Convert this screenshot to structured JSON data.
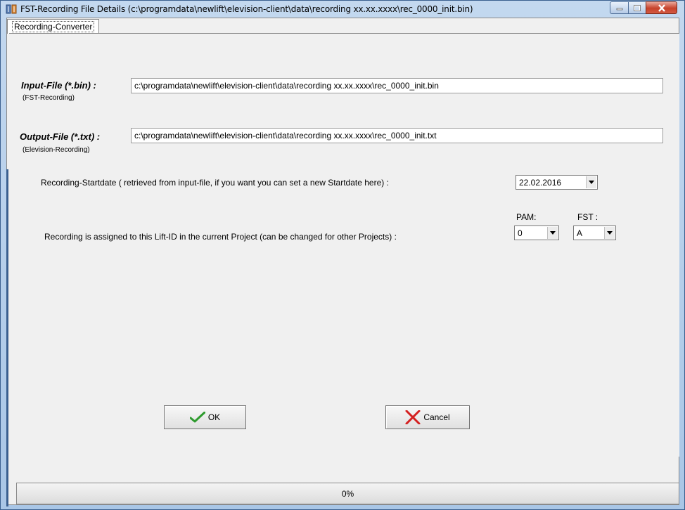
{
  "window": {
    "title": "FST-Recording File Details (c:\\programdata\\newlift\\elevision-client\\data\\recording xx.xx.xxxx\\rec_0000_init.bin)"
  },
  "tabs": [
    {
      "label": "Recording-Converter",
      "selected": true
    }
  ],
  "input_file": {
    "label": "Input-File (*.bin) :",
    "sublabel": "(FST-Recording)",
    "value": "c:\\programdata\\newlift\\elevision-client\\data\\recording xx.xx.xxxx\\rec_0000_init.bin"
  },
  "output_file": {
    "label": "Output-File (*.txt) :",
    "sublabel": "(Elevision-Recording)",
    "value": "c:\\programdata\\newlift\\elevision-client\\data\\recording xx.xx.xxxx\\rec_0000_init.txt"
  },
  "startdate": {
    "label": "Recording-Startdate ( retrieved from input-file, if you want you can set a new Startdate here) :",
    "value": "22.02.2016"
  },
  "lift_assignment": {
    "label": "Recording  is  assigned to this Lift-ID in the current Project (can be changed for other Projects) :",
    "pam_label": "PAM:",
    "pam_value": "0",
    "fst_label": "FST :",
    "fst_value": "A"
  },
  "buttons": {
    "ok": "OK",
    "cancel": "Cancel"
  },
  "status": {
    "progress_text": "0%",
    "progress": 0
  },
  "colors": {
    "ok_check": "#2e9b2e",
    "cancel_x": "#d42020",
    "close_button": "#c7422b"
  }
}
